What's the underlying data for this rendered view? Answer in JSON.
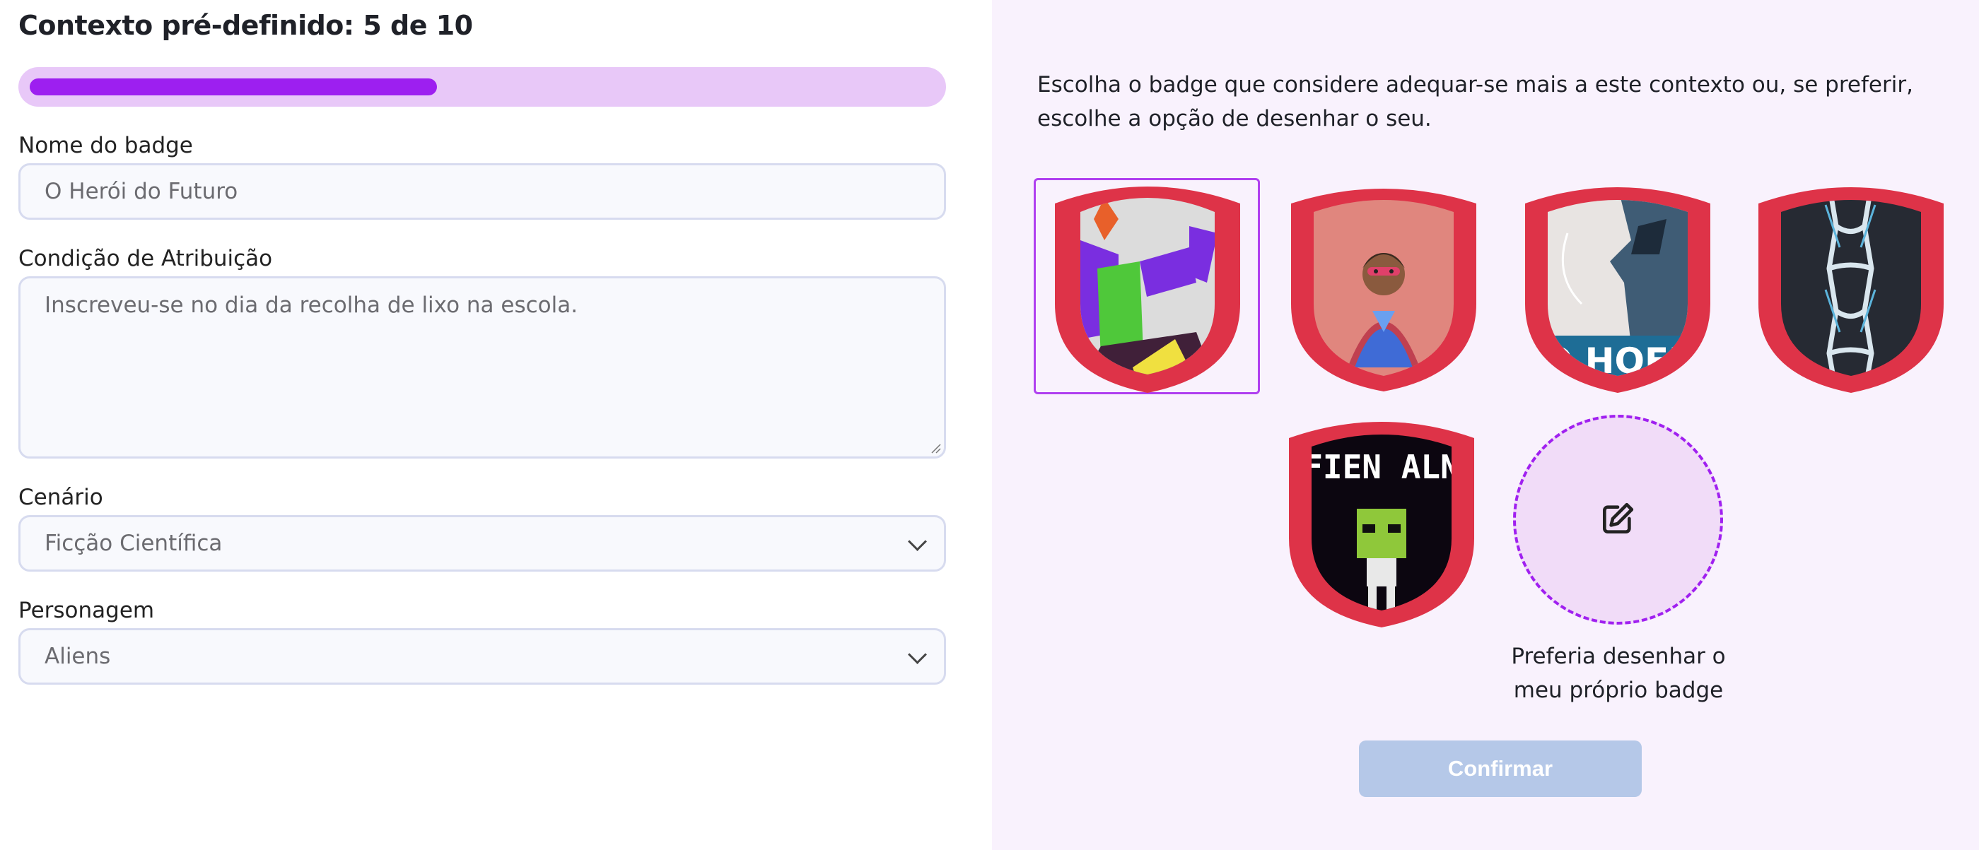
{
  "header": {
    "title": "Contexto pré-definido: 5 de 10"
  },
  "progress": {
    "current": 5,
    "total": 10,
    "fraction": 0.45,
    "fill_color": "#9d1ff0",
    "track_color": "#e8c8f8"
  },
  "form": {
    "badge_name": {
      "label": "Nome do badge",
      "value": "O Herói do Futuro"
    },
    "condition": {
      "label": "Condição de Atribuição",
      "value": "Inscreveu-se no dia da recolha de lixo na escola."
    },
    "scenario": {
      "label": "Cenário",
      "value": "Ficção Científica"
    },
    "character": {
      "label": "Personagem",
      "value": "Aliens"
    }
  },
  "badges": {
    "description": "Escolha o badge que considere adequar-se mais a este contexto ou, se preferir, escolhe a opção de desenhar o seu.",
    "items": [
      {
        "id": "abstract-shapes-badge",
        "selected": true
      },
      {
        "id": "superhero-emoji-badge",
        "selected": false
      },
      {
        "id": "poster-art-badge",
        "selected": false,
        "partial_text": "O HOFF"
      },
      {
        "id": "figures-pattern-badge",
        "selected": false
      },
      {
        "id": "pixel-alien-badge",
        "selected": false,
        "text": "FIEN ALN"
      }
    ],
    "draw_own": {
      "label": "Preferia desenhar o meu próprio badge",
      "icon": "edit-icon"
    },
    "shield_color": "#de3348",
    "selection_color": "#b040f0"
  },
  "actions": {
    "confirm_label": "Confirmar",
    "confirm_enabled": false
  }
}
